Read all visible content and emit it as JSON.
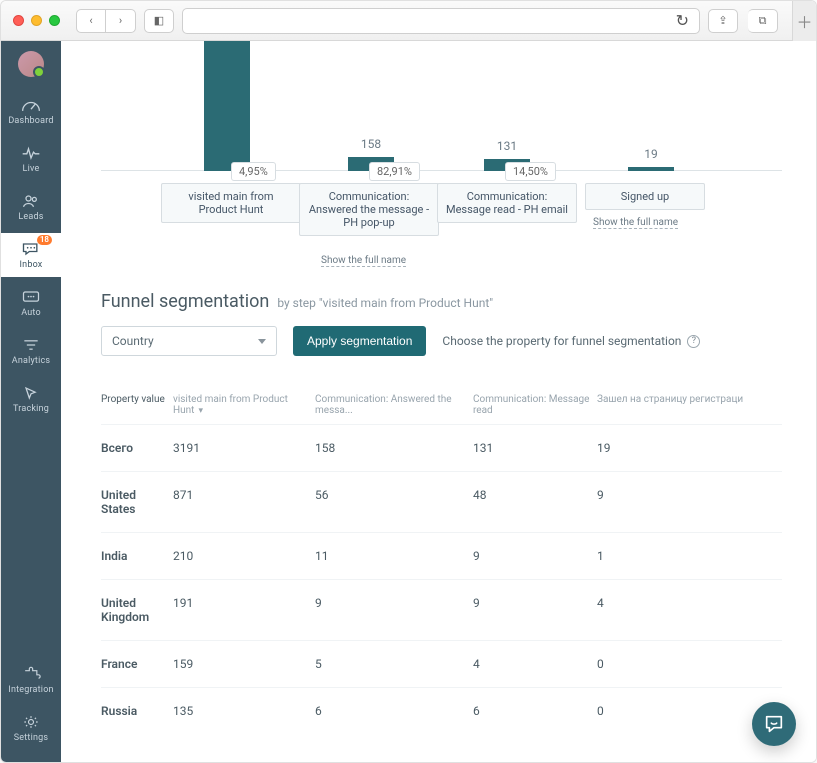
{
  "browser": {
    "reload_icon": "↻",
    "back_icon": "‹",
    "fwd_icon": "›",
    "share_icon": "⇪",
    "tabs_icon": "⧉",
    "plus_icon": "＋",
    "sidebar_icon": "◧"
  },
  "sidebar": {
    "items": [
      {
        "label": "Dashboard"
      },
      {
        "label": "Live"
      },
      {
        "label": "Leads"
      },
      {
        "label": "Inbox",
        "badge": "18"
      },
      {
        "label": "Auto"
      },
      {
        "label": "Analytics"
      },
      {
        "label": "Tracking"
      }
    ],
    "bottom": [
      {
        "label": "Integration"
      },
      {
        "label": "Settings"
      }
    ]
  },
  "chart_data": {
    "type": "bar",
    "title": "",
    "categories": [
      "visited main from Product Hunt",
      "Communication: Answered the message - PH pop-up",
      "Communication: Message read - PH email",
      "Signed up"
    ],
    "values": [
      3191,
      158,
      131,
      19
    ],
    "rates": [
      "4,95%",
      "82,91%",
      "14,50%"
    ],
    "displayed_values": [
      null,
      158,
      131,
      19
    ],
    "ylim": [
      0,
      3200
    ]
  },
  "funnel": {
    "show_full_link": "Show the full name"
  },
  "segmentation": {
    "heading": "Funnel segmentation",
    "subtext": "by step \"visited main from Product Hunt\"",
    "dropdown": {
      "selected": "Country"
    },
    "apply_label": "Apply segmentation",
    "hint": "Choose the property for funnel segmentation",
    "columns": [
      "Property value",
      "visited main from Product Hunt",
      "Communication: Answered the messa...",
      "Communication: Message read",
      "Зашел на страницу регистраци"
    ],
    "rows": [
      {
        "label": "Всего",
        "v": [
          "3191",
          "158",
          "131",
          "19"
        ]
      },
      {
        "label": "United States",
        "v": [
          "871",
          "56",
          "48",
          "9"
        ]
      },
      {
        "label": "India",
        "v": [
          "210",
          "11",
          "9",
          "1"
        ]
      },
      {
        "label": "United Kingdom",
        "v": [
          "191",
          "9",
          "9",
          "4"
        ]
      },
      {
        "label": "France",
        "v": [
          "159",
          "5",
          "4",
          "0"
        ]
      },
      {
        "label": "Russia",
        "v": [
          "135",
          "6",
          "6",
          "0"
        ]
      }
    ]
  }
}
